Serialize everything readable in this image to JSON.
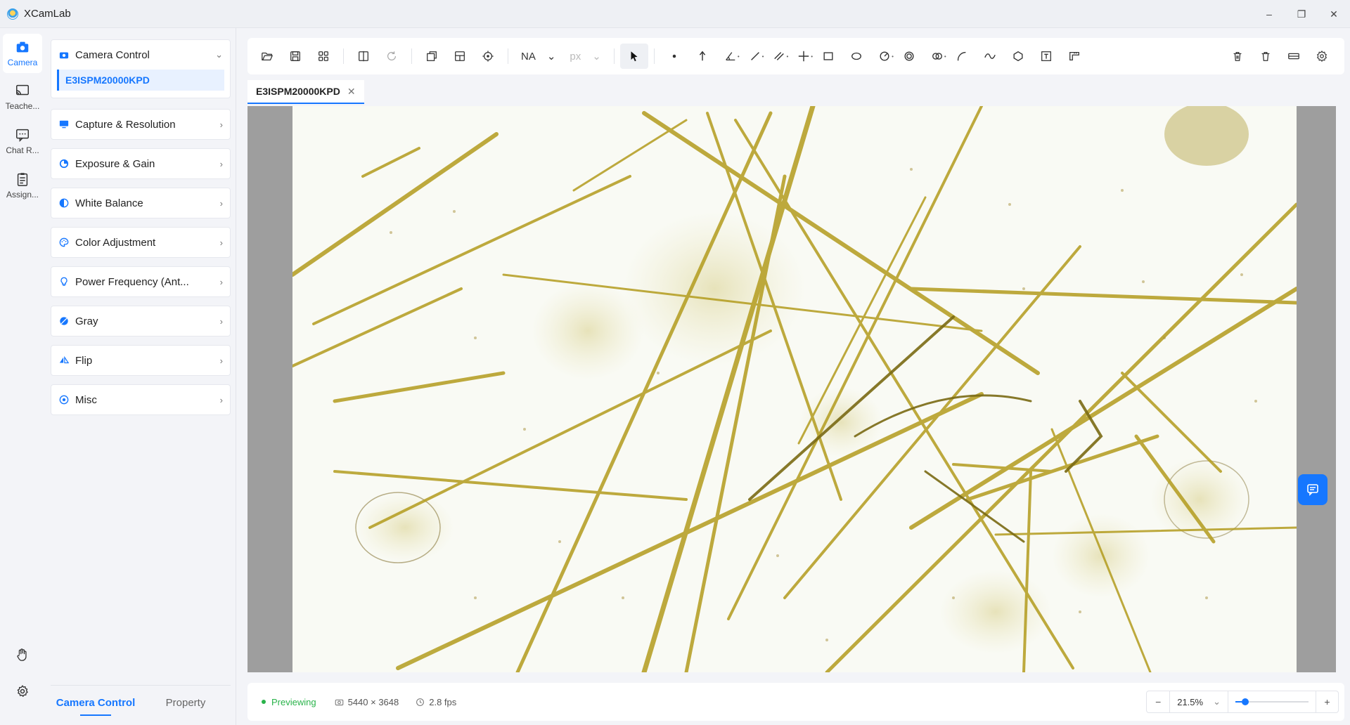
{
  "app": {
    "title": "XCamLab"
  },
  "window_controls": {
    "minimize": "–",
    "restore": "❐",
    "close": "✕"
  },
  "rail": {
    "items": [
      {
        "label": "Camera",
        "icon": "camera-icon",
        "active": true
      },
      {
        "label": "Teache...",
        "icon": "cast-icon"
      },
      {
        "label": "Chat R...",
        "icon": "chat-icon"
      },
      {
        "label": "Assign...",
        "icon": "clipboard-icon"
      }
    ],
    "bottom": [
      "hand-icon",
      "gear-icon"
    ]
  },
  "sidebar": {
    "groups": [
      {
        "label": "Camera Control",
        "icon": "camera-icon",
        "expanded": true,
        "sub_items": [
          "E3ISPM20000KPD"
        ]
      },
      {
        "label": "Capture & Resolution",
        "icon": "monitor-icon"
      },
      {
        "label": "Exposure & Gain",
        "icon": "exposure-icon"
      },
      {
        "label": "White Balance",
        "icon": "half-circle-icon"
      },
      {
        "label": "Color Adjustment",
        "icon": "palette-icon"
      },
      {
        "label": "Power Frequency (Ant...",
        "icon": "bulb-icon"
      },
      {
        "label": "Gray",
        "icon": "gray-icon"
      },
      {
        "label": "Flip",
        "icon": "flip-icon"
      },
      {
        "label": "Misc",
        "icon": "misc-icon"
      }
    ],
    "tabs": [
      {
        "label": "Camera Control",
        "active": true
      },
      {
        "label": "Property"
      }
    ]
  },
  "toolbar": {
    "na_select": "NA",
    "unit_select": "px"
  },
  "document_tab": {
    "label": "E3ISPM20000KPD"
  },
  "status": {
    "state": "Previewing",
    "resolution": "5440 × 3648",
    "fps": "2.8 fps",
    "zoom": "21.5%",
    "zoom_level": 0.215
  },
  "colors": {
    "accent": "#1677ff",
    "status_green": "#29b34a",
    "specimen": "#b59a1e"
  }
}
